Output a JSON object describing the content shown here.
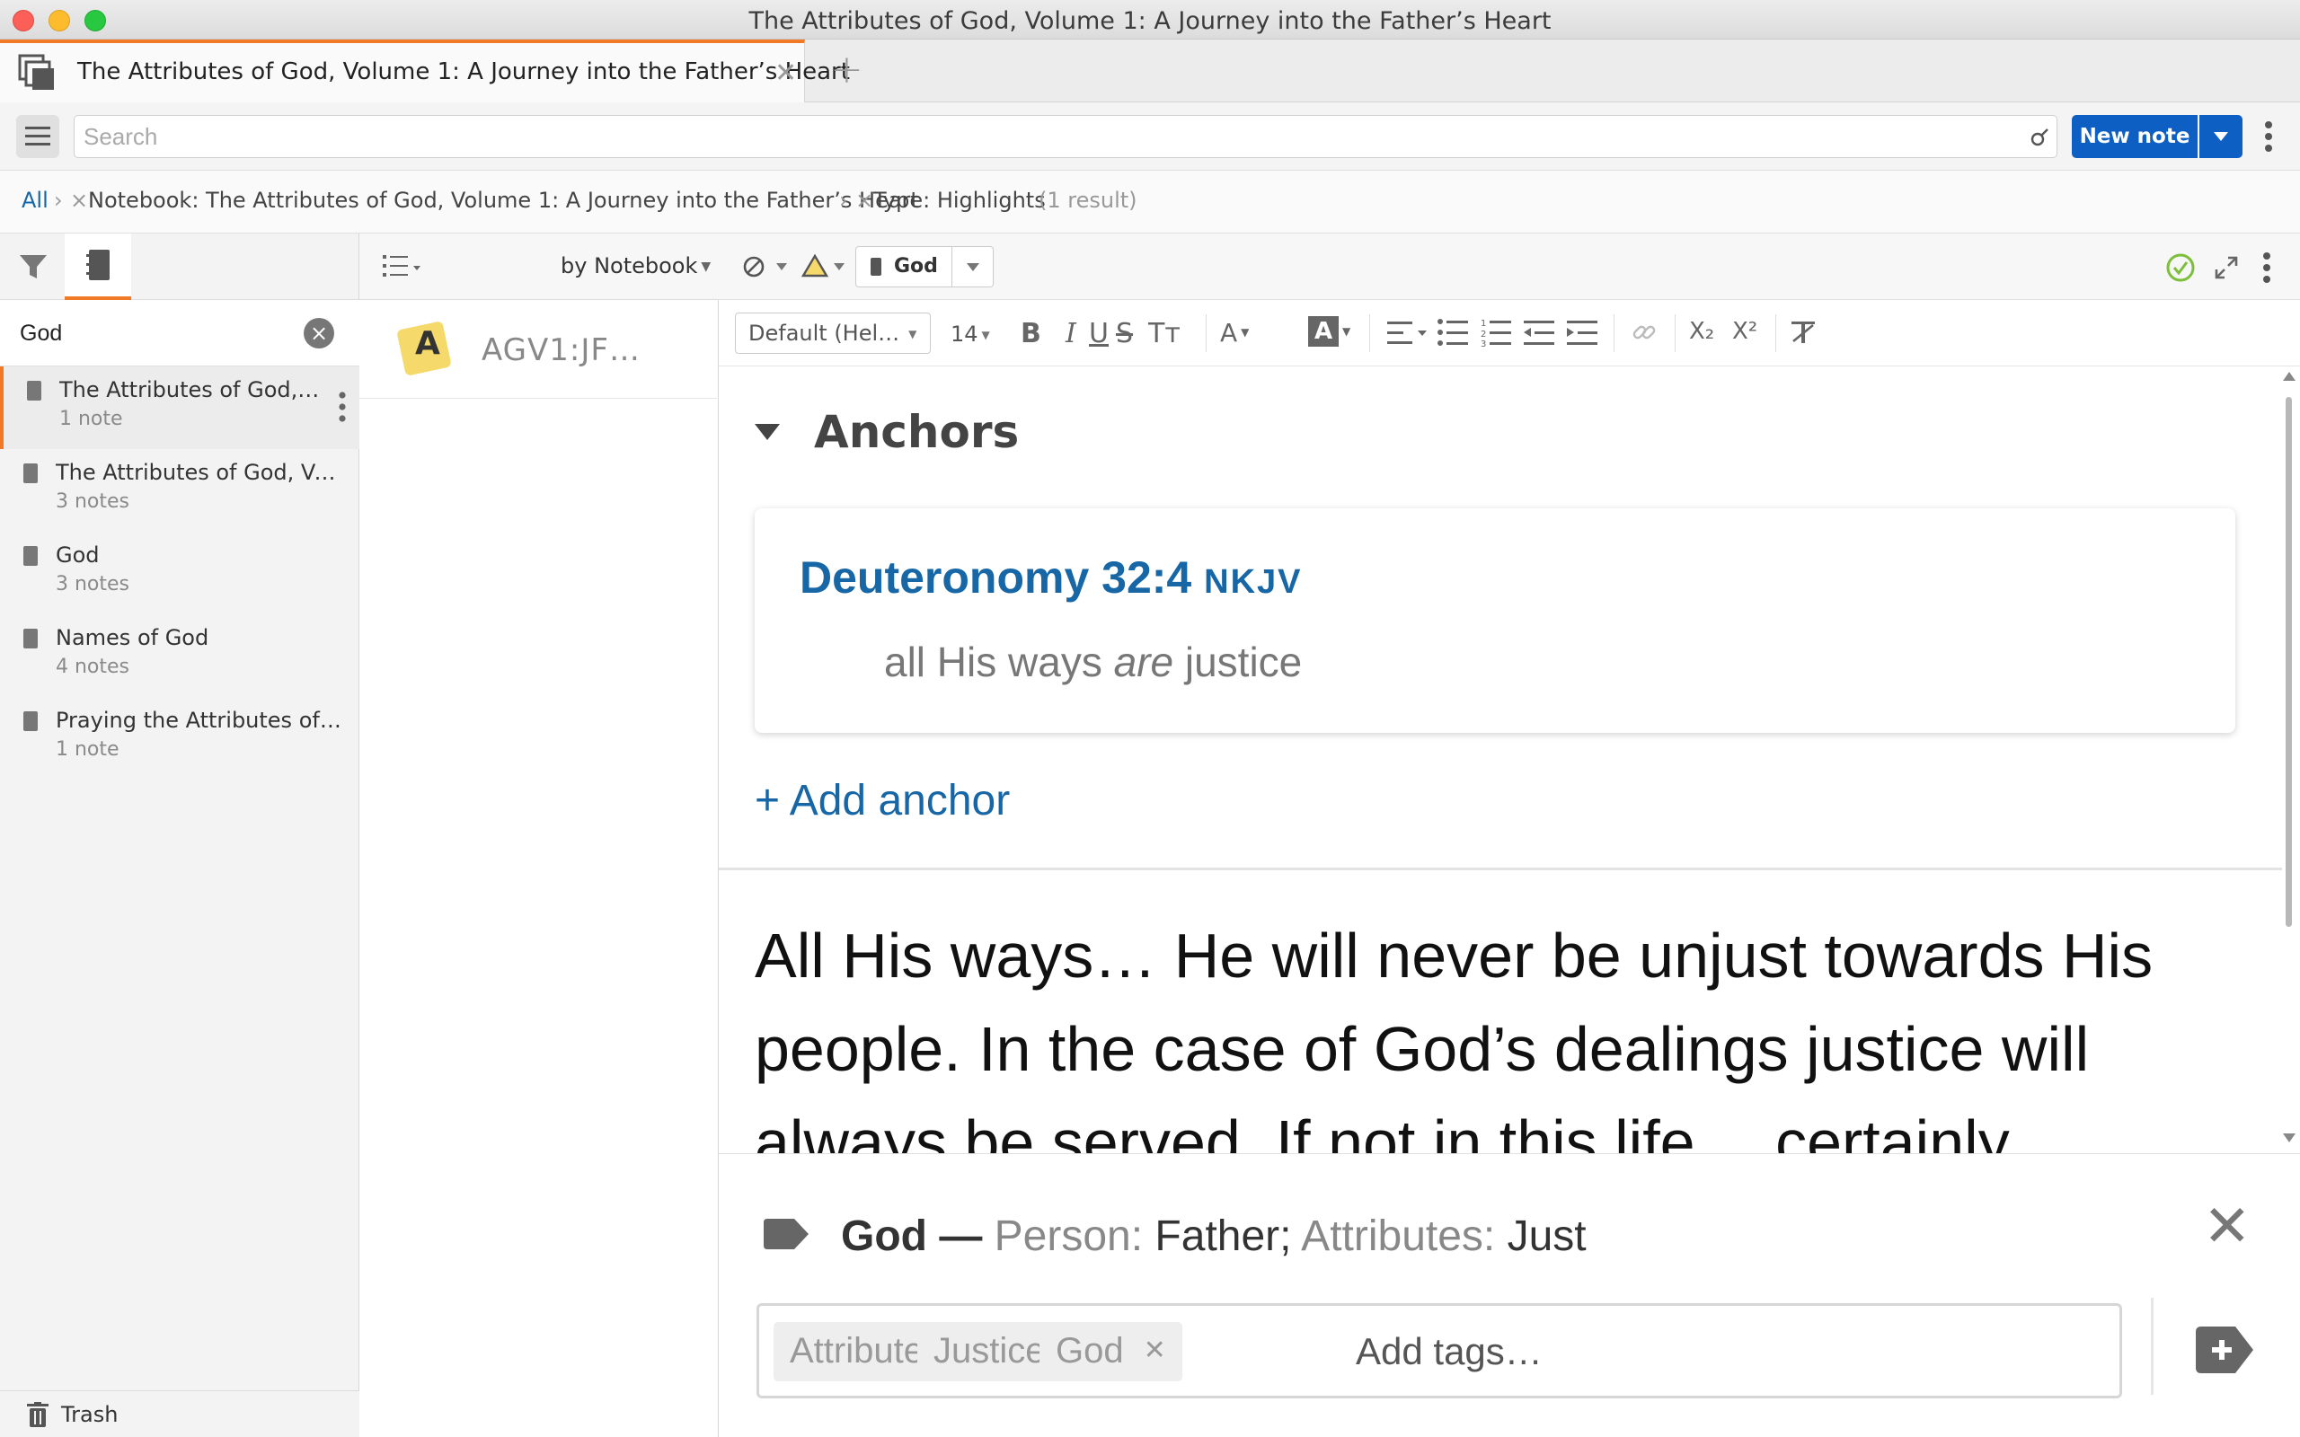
{
  "window": {
    "title": "The Attributes of God, Volume 1: A Journey into the Father’s Heart"
  },
  "tab": {
    "title": "The Attributes of God, Volume 1: A Journey into the Father’s Heart",
    "close": "✕",
    "add": "+"
  },
  "toolbar": {
    "search_placeholder": "Search",
    "new_note_label": "New note"
  },
  "breadcrumb": {
    "all": "All",
    "sep": "›",
    "remove": "×",
    "notebook": "Notebook: The Attributes of God, Volume 1: A Journey into the Father’s Heart",
    "type": "Type: Highlights",
    "result_count": "(1 result)"
  },
  "sidebar": {
    "filter_value": "God",
    "notebooks": [
      {
        "title": "The Attributes of God, V…",
        "count": "1 note"
      },
      {
        "title": "The Attributes of God, Volu…",
        "count": "3 notes"
      },
      {
        "title": "God",
        "count": "3 notes"
      },
      {
        "title": "Names of God",
        "count": "4 notes"
      },
      {
        "title": "Praying the Attributes of God",
        "count": "1 note"
      }
    ],
    "trash_label": "Trash"
  },
  "note_list": {
    "sort_label": "by Notebook",
    "items": [
      {
        "letter": "A",
        "title": "AGV1:JF…"
      }
    ]
  },
  "editor": {
    "notebook_button": "God",
    "font_family": "Default (Hel…",
    "font_size": "14",
    "anchors_heading": "Anchors",
    "anchor": {
      "reference": "Deuteronomy 32:4",
      "version": "NKJV",
      "text_before": "all His ways ",
      "text_italic": "are",
      "text_after": " justice"
    },
    "add_anchor": "+ Add anchor",
    "body": "All His ways… He will never be unjust towards His people. In the case of God’s dealings justice will always be served. If not in this life… certainly"
  },
  "tag_panel": {
    "title": "God",
    "dash": " — ",
    "person_label": "Person: ",
    "person_value": "Father;",
    "attr_label": " Attributes: ",
    "attr_value": "Just",
    "tags": [
      "Attributes",
      "Justice",
      "God"
    ],
    "add_placeholder": "Add tags…"
  },
  "colors": {
    "accent_orange": "#f07a26",
    "primary_blue": "#0d5fc3",
    "link_blue": "#1767a6",
    "check_green": "#7cbf3a",
    "highlight_yellow": "#f6d96b"
  }
}
